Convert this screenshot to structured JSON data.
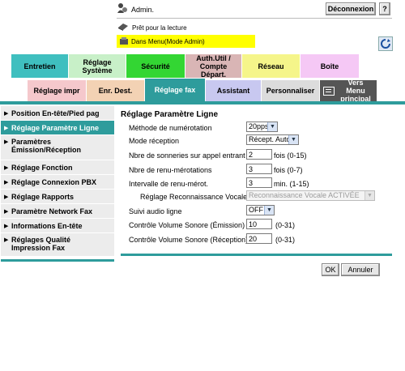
{
  "header": {
    "user": "Admin.",
    "logout_label": "Déconnexion",
    "help_label": "?",
    "status_ready": "Prêt pour la lecture",
    "mode_label": "Dans Menu(Mode Admin)"
  },
  "main_tabs": [
    {
      "label": "Entretien"
    },
    {
      "label": "Réglage Système"
    },
    {
      "label": "Sécurité"
    },
    {
      "label": "Auth.Util / Compte Départ."
    },
    {
      "label": "Réseau"
    },
    {
      "label": "Boîte"
    }
  ],
  "sub_tabs": [
    {
      "label": "Réglage impr"
    },
    {
      "label": "Enr. Dest."
    },
    {
      "label": "Réglage fax"
    },
    {
      "label": "Assistant"
    },
    {
      "label": "Personnaliser"
    },
    {
      "label": "Vers Menu principal"
    }
  ],
  "sidebar": {
    "items": [
      {
        "label": "Position En-tête/Pied pag"
      },
      {
        "label": "Réglage Paramètre Ligne"
      },
      {
        "label": "Paramètres Émission/Réception"
      },
      {
        "label": "Réglage Fonction"
      },
      {
        "label": "Réglage Connexion PBX"
      },
      {
        "label": "Réglage Rapports"
      },
      {
        "label": "Paramètre Network Fax"
      },
      {
        "label": "Informations En-tête"
      },
      {
        "label": "Réglages Qualité Impression Fax"
      }
    ]
  },
  "form": {
    "title": "Réglage Paramètre Ligne",
    "fields": [
      {
        "label": "Méthode de numérotation",
        "value": "20pps"
      },
      {
        "label": "Mode réception",
        "value": "Récept. Auto"
      },
      {
        "label": "Nbre de sonneries sur appel entrant",
        "value": "2",
        "unit": "fois (0-15)"
      },
      {
        "label": "Nbre de renu-mérotations",
        "value": "3",
        "unit": "fois (0-7)"
      },
      {
        "label": "Intervalle de renu-mérot.",
        "value": "3",
        "unit": "min. (1-15)"
      },
      {
        "label": "Réglage Reconnaissance Vocale",
        "value": "Reconnaissance Vocale ACTIVÉE"
      },
      {
        "label": "Suivi audio ligne",
        "value": "OFF"
      },
      {
        "label": "Contrôle Volume Sonore (Émission)",
        "value": "10",
        "unit": "(0-31)"
      },
      {
        "label": "Contrôle Volume Sonore (Réception)",
        "value": "20",
        "unit": "(0-31)"
      }
    ],
    "ok_label": "OK",
    "cancel_label": "Annuler"
  },
  "colors": {
    "tab_entretien": "#3fbfbf",
    "tab_systeme": "#c8f0c8",
    "tab_securite": "#33d633",
    "tab_auth": "#d9b5b5",
    "tab_reseau": "#f5f58a",
    "tab_boite": "#f5c8f5",
    "active_teal": "#2e9c9c",
    "mode_bar": "#ffff00"
  }
}
